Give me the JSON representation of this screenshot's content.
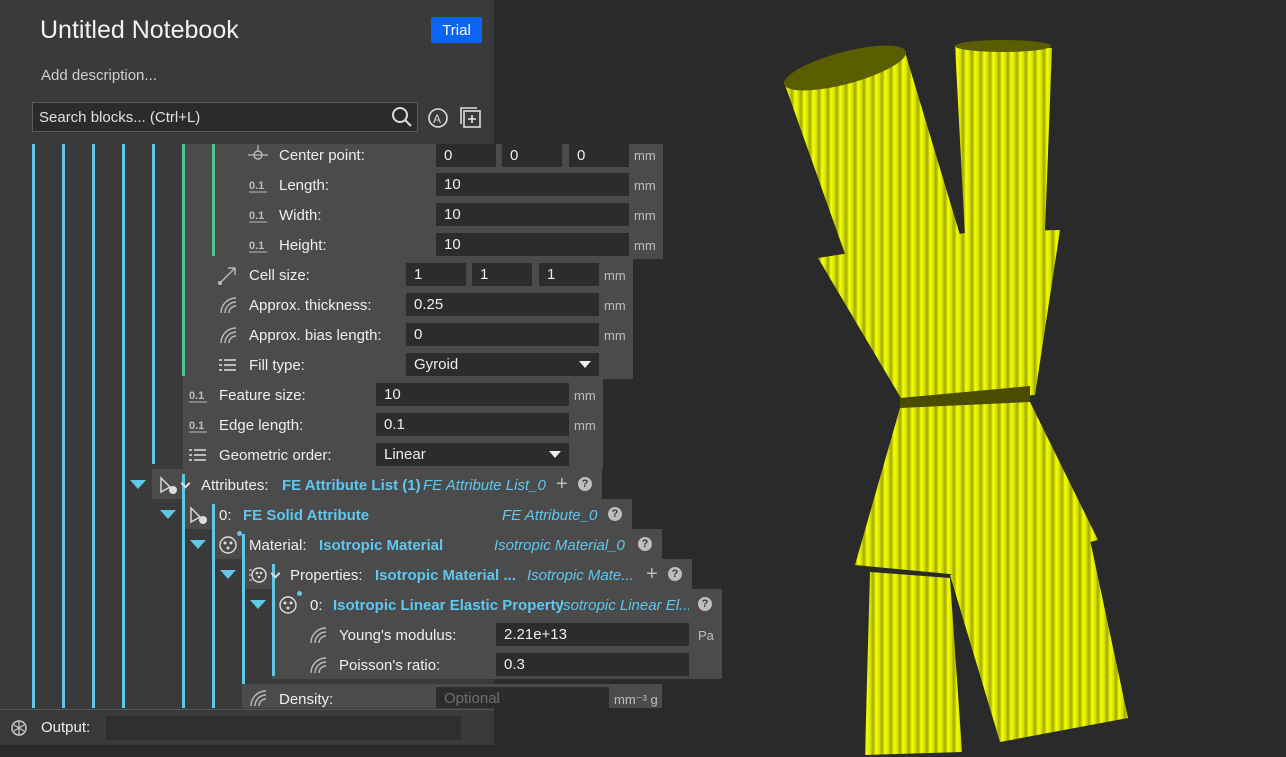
{
  "notebook": {
    "title": "Untitled Notebook",
    "badge": "Trial",
    "description": "Add description..."
  },
  "search": {
    "placeholder": "Search blocks... (Ctrl+L)"
  },
  "box_params": {
    "center_point": {
      "label": "Center point:",
      "x": "0",
      "y": "0",
      "z": "0",
      "unit": "mm"
    },
    "length": {
      "label": "Length:",
      "value": "10",
      "unit": "mm"
    },
    "width": {
      "label": "Width:",
      "value": "10",
      "unit": "mm"
    },
    "height": {
      "label": "Height:",
      "value": "10",
      "unit": "mm"
    }
  },
  "lattice": {
    "cell_size": {
      "label": "Cell size:",
      "x": "1",
      "y": "1",
      "z": "1",
      "unit": "mm"
    },
    "approx_thickness": {
      "label": "Approx. thickness:",
      "value": "0.25",
      "unit": "mm"
    },
    "approx_bias": {
      "label": "Approx. bias length:",
      "value": "0",
      "unit": "mm"
    },
    "fill_type": {
      "label": "Fill type:",
      "value": "Gyroid"
    }
  },
  "mesh": {
    "feature_size": {
      "label": "Feature size:",
      "value": "10",
      "unit": "mm"
    },
    "edge_length": {
      "label": "Edge length:",
      "value": "0.1",
      "unit": "mm"
    },
    "geometric_order": {
      "label": "Geometric order:",
      "value": "Linear"
    }
  },
  "attributes": {
    "label": "Attributes:",
    "link": "FE Attribute List (1)",
    "name": "FE Attribute List_0"
  },
  "solid_attr": {
    "index": "0:",
    "link": "FE Solid Attribute",
    "name": "FE Attribute_0"
  },
  "material": {
    "label": "Material:",
    "link": "Isotropic Material",
    "name": "Isotropic Material_0"
  },
  "properties": {
    "label": "Properties:",
    "link": "Isotropic Material ...",
    "name": "Isotropic Mate..."
  },
  "elastic": {
    "index": "0:",
    "link": "Isotropic Linear Elastic Property",
    "name": "Isotropic Linear El..."
  },
  "youngs": {
    "label": "Young's modulus:",
    "value": "2.21e+13",
    "unit": "Pa"
  },
  "poisson": {
    "label": "Poisson's ratio:",
    "value": "0.3"
  },
  "density": {
    "label": "Density:",
    "placeholder": "Optional",
    "unit": "mm⁻³ g"
  },
  "output": {
    "label": "Output:"
  },
  "colors": {
    "accent": "#0a64f5",
    "tree_line": "#5fc8e6",
    "green_line": "#4fc38f",
    "model": "#e6f000"
  }
}
